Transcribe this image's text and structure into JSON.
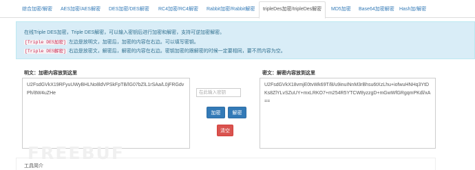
{
  "tabs": [
    {
      "label": "综合加密/解密",
      "active": false
    },
    {
      "label": "AES加密/AES解密",
      "active": false
    },
    {
      "label": "DES加密/DES解密",
      "active": false
    },
    {
      "label": "RC4加密/RC4解密",
      "active": false
    },
    {
      "label": "Rabbit加密/Rabbit解密",
      "active": false
    },
    {
      "label": "tripleDes加密/tripleDes解密",
      "active": true
    },
    {
      "label": "MD5加密",
      "active": false
    },
    {
      "label": "Base64加密解密",
      "active": false
    },
    {
      "label": "Hash加/解密",
      "active": false
    }
  ],
  "intro": {
    "line1": "在线Triple DES加密，Triple DES解密，可以输入密钥后进行加密和解密，支持可逆加密解密。",
    "line2_tag": "[Triple DES加密]",
    "line2_text": "左边是放明文，加密后，加密的内容在右边。可以填写密钥。",
    "line3_tag": "[Triple DES解密]",
    "line3_text": "右边是放密文，解密后，解密的内容在右边。密钥加密的跟解密的时候一定要相同，要不然内容为空。"
  },
  "plaintext": {
    "label": "明文：加密内容放到这里",
    "value": "U2FsdGVkX19RFyuUWyBHLNo8ldVPSkFpTB/lG07bZlL1rSAa/L0jFRGdvPh/8W4uZHe"
  },
  "ciphertext": {
    "label": "密文：解密内容放到这里",
    "value": "U2FsdGVkX18vmjE0tvWk69T/B/u9inuINnM3rBhsu6tXzLhu+iofwuHNHq3YtDKs8ZlYLvSZuUY+mxLRKO7+m254R5YTCW8yzzgD+mGwWfGRgqmPKdl/xA=="
  },
  "controls": {
    "password_placeholder": "在此输入密钥",
    "encrypt_label": "加密",
    "decrypt_label": "解密",
    "clear_label": "清空"
  },
  "watermark": "FREEBUF",
  "footer": {
    "tool_intro_label": "工具简介"
  },
  "colors": {
    "accent": "#337ab7",
    "danger": "#d9534f",
    "info_bg": "#d9edf7"
  }
}
